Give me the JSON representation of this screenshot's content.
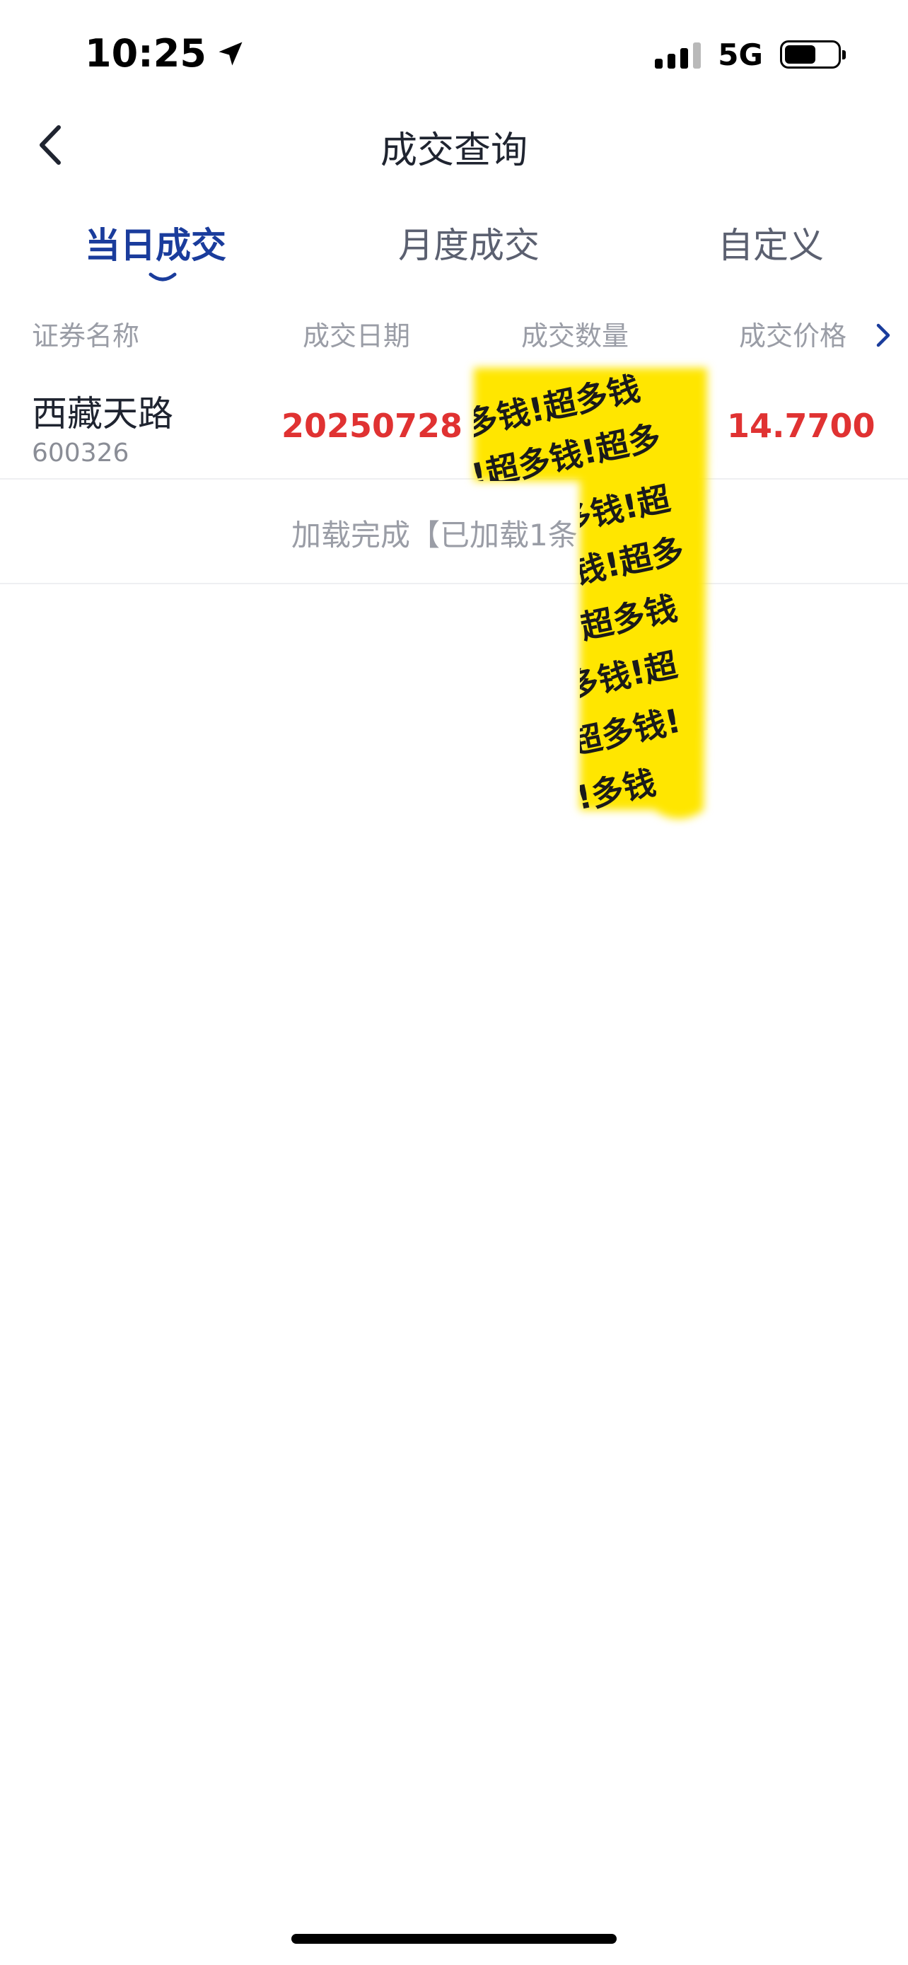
{
  "status_bar": {
    "time": "10:25",
    "network": "5G",
    "signal_bars_active": 3,
    "signal_bars_total": 4,
    "battery_level": 0.6
  },
  "nav": {
    "title": "成交查询"
  },
  "tabs": [
    {
      "label": "当日成交",
      "active": true
    },
    {
      "label": "月度成交",
      "active": false
    },
    {
      "label": "自定义",
      "active": false
    }
  ],
  "table": {
    "headers": [
      "证券名称",
      "成交日期",
      "成交数量",
      "成交价格"
    ],
    "rows": [
      {
        "name": "西藏天路",
        "code": "600326",
        "date": "20250728",
        "quantity": "",
        "price": "14.7700"
      }
    ]
  },
  "load_status": "加载完成【已加载1条",
  "redaction_sticker": {
    "text": "多钱!超多钱!超",
    "color": "#ffe600"
  },
  "colors": {
    "accent": "#1a3c9c",
    "price_red": "#e03232",
    "muted": "#9a9da6"
  }
}
